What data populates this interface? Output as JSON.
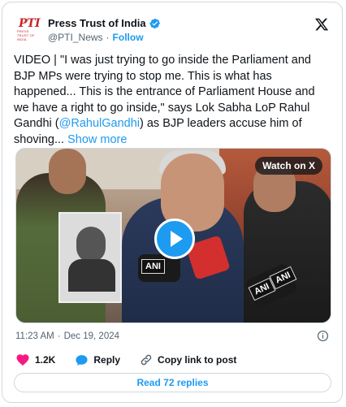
{
  "author": {
    "name": "Press Trust of India",
    "handle": "@PTI_News",
    "follow_label": "Follow",
    "avatar_logo": "PTI",
    "avatar_sub": "PRESS TRUST OF INDIA",
    "verified_color": "#1d9bf0"
  },
  "tweet": {
    "text_part1": "VIDEO | \"I was just trying to go inside the Parliament and BJP MPs were trying to stop me. This is what has happened... This is the entrance of Parliament House and we have a right to go inside,\" says Lok Sabha LoP Rahul Gandhi (",
    "mention": "@RahulGandhi",
    "text_part2": ") as BJP leaders accuse him of shoving...",
    "show_more": "Show more"
  },
  "media": {
    "watch_label": "Watch on X",
    "mic_label_1": "ANI",
    "mic_label_2": "ANI",
    "mic_label_3": "ANI"
  },
  "meta": {
    "time": "11:23 AM",
    "date": "Dec 19, 2024"
  },
  "actions": {
    "likes": "1.2K",
    "reply_label": "Reply",
    "copy_label": "Copy link to post"
  },
  "read_replies_label": "Read 72 replies",
  "colors": {
    "accent": "#1d9bf0",
    "like": "#f91880",
    "text_secondary": "#536471"
  }
}
